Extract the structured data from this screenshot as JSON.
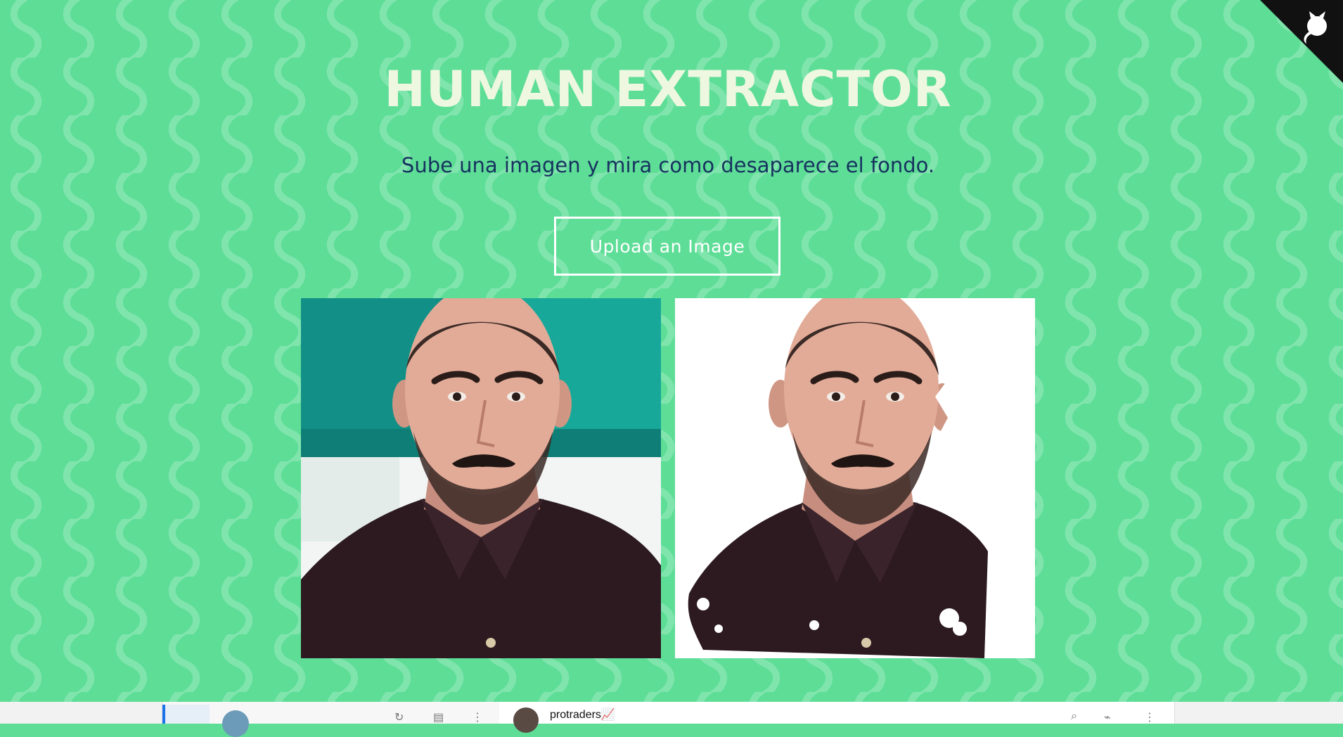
{
  "hero": {
    "title": "HUMAN EXTRACTOR",
    "subtitle": "Sube una imagen y mira como desaparece el fondo.",
    "upload_label": "Upload an Image"
  },
  "images": {
    "original": "original-portrait-photo",
    "extracted": "background-removed-portrait"
  },
  "corner": {
    "icon": "github-octocat-icon"
  },
  "taskbar": {
    "chat_name": "protraders",
    "chat_emoji": "📈"
  },
  "colors": {
    "background": "#5edd97",
    "title": "#eef7df",
    "subtitle": "#17325f",
    "button_border": "#ffffff",
    "corner": "#111111"
  }
}
